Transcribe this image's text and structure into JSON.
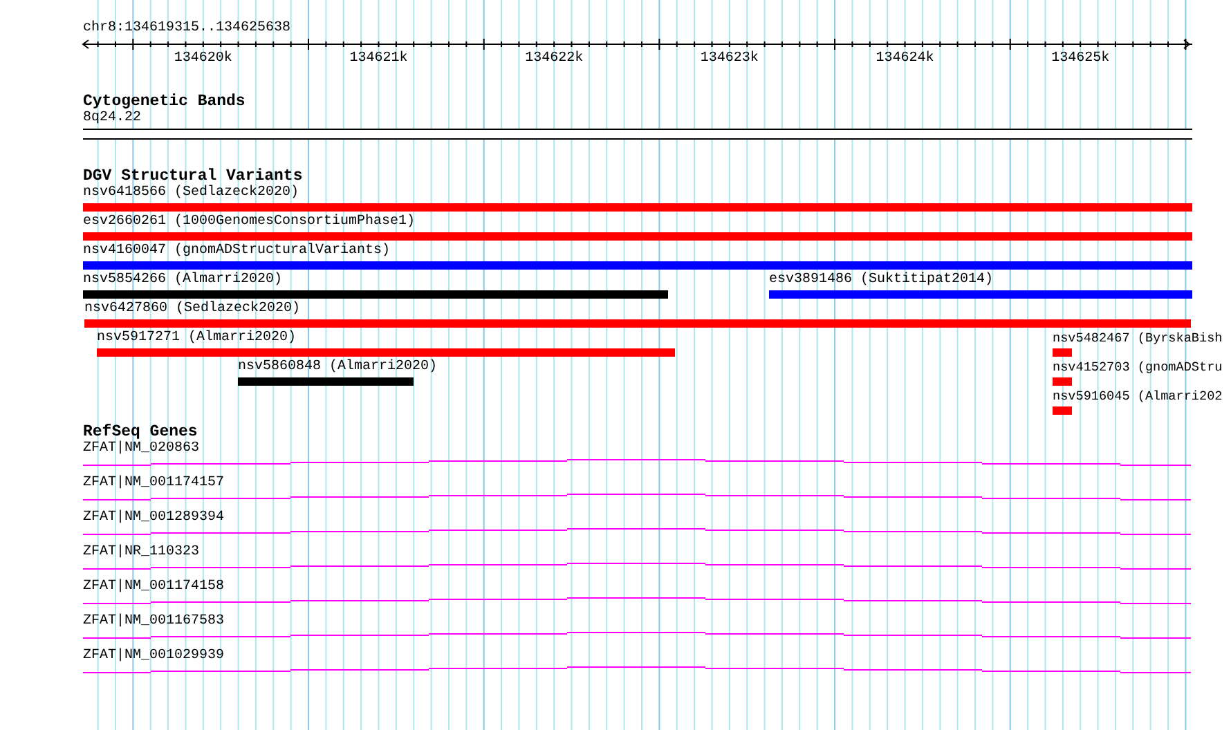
{
  "ruler": {
    "region": "chr8:134619315..134625638",
    "tick_labels": [
      "134620k",
      "134621k",
      "134622k",
      "134623k",
      "134624k",
      "134625k"
    ]
  },
  "cytogenetic_bands": {
    "title": "Cytogenetic Bands",
    "band": "8q24.22"
  },
  "dgv_structural_variants": {
    "title": "DGV Structural Variants",
    "rows": [
      {
        "features": [
          {
            "label": "nsv6418566 (Sedlazeck2020)",
            "color": "#ff0000"
          }
        ]
      },
      {
        "features": [
          {
            "label": "esv2660261 (1000GenomesConsortiumPhase1)",
            "color": "#ff0000"
          }
        ]
      },
      {
        "features": [
          {
            "label": "nsv4160047 (gnomADStructuralVariants)",
            "color": "#0000ff"
          }
        ]
      },
      {
        "features": [
          {
            "label": "nsv5854266 (Almarri2020)",
            "color": "#000000"
          },
          {
            "label": "esv3891486 (Suktitipat2014)",
            "color": "#0000ff"
          }
        ]
      },
      {
        "features": [
          {
            "label": "nsv6427860 (Sedlazeck2020)",
            "color": "#ff0000"
          }
        ]
      },
      {
        "features": [
          {
            "label": "nsv5917271 (Almarri2020)",
            "color": "#ff0000"
          },
          {
            "label": "nsv5482467 (ByrskaBish",
            "color": "#ff0000"
          }
        ]
      },
      {
        "features": [
          {
            "label": "nsv5860848 (Almarri2020)",
            "color": "#000000"
          },
          {
            "label": "nsv4152703 (gnomADStru",
            "color": "#ff0000"
          }
        ]
      },
      {
        "features": [
          {
            "label": "nsv5916045 (Almarri202",
            "color": "#ff0000"
          }
        ]
      }
    ]
  },
  "refseq_genes": {
    "title": "RefSeq Genes",
    "genes": [
      {
        "label": "ZFAT|NM_020863"
      },
      {
        "label": "ZFAT|NM_001174157"
      },
      {
        "label": "ZFAT|NM_001289394"
      },
      {
        "label": "ZFAT|NR_110323"
      },
      {
        "label": "ZFAT|NM_001174158"
      },
      {
        "label": "ZFAT|NM_001167583"
      },
      {
        "label": "ZFAT|NM_001029939"
      }
    ]
  }
}
